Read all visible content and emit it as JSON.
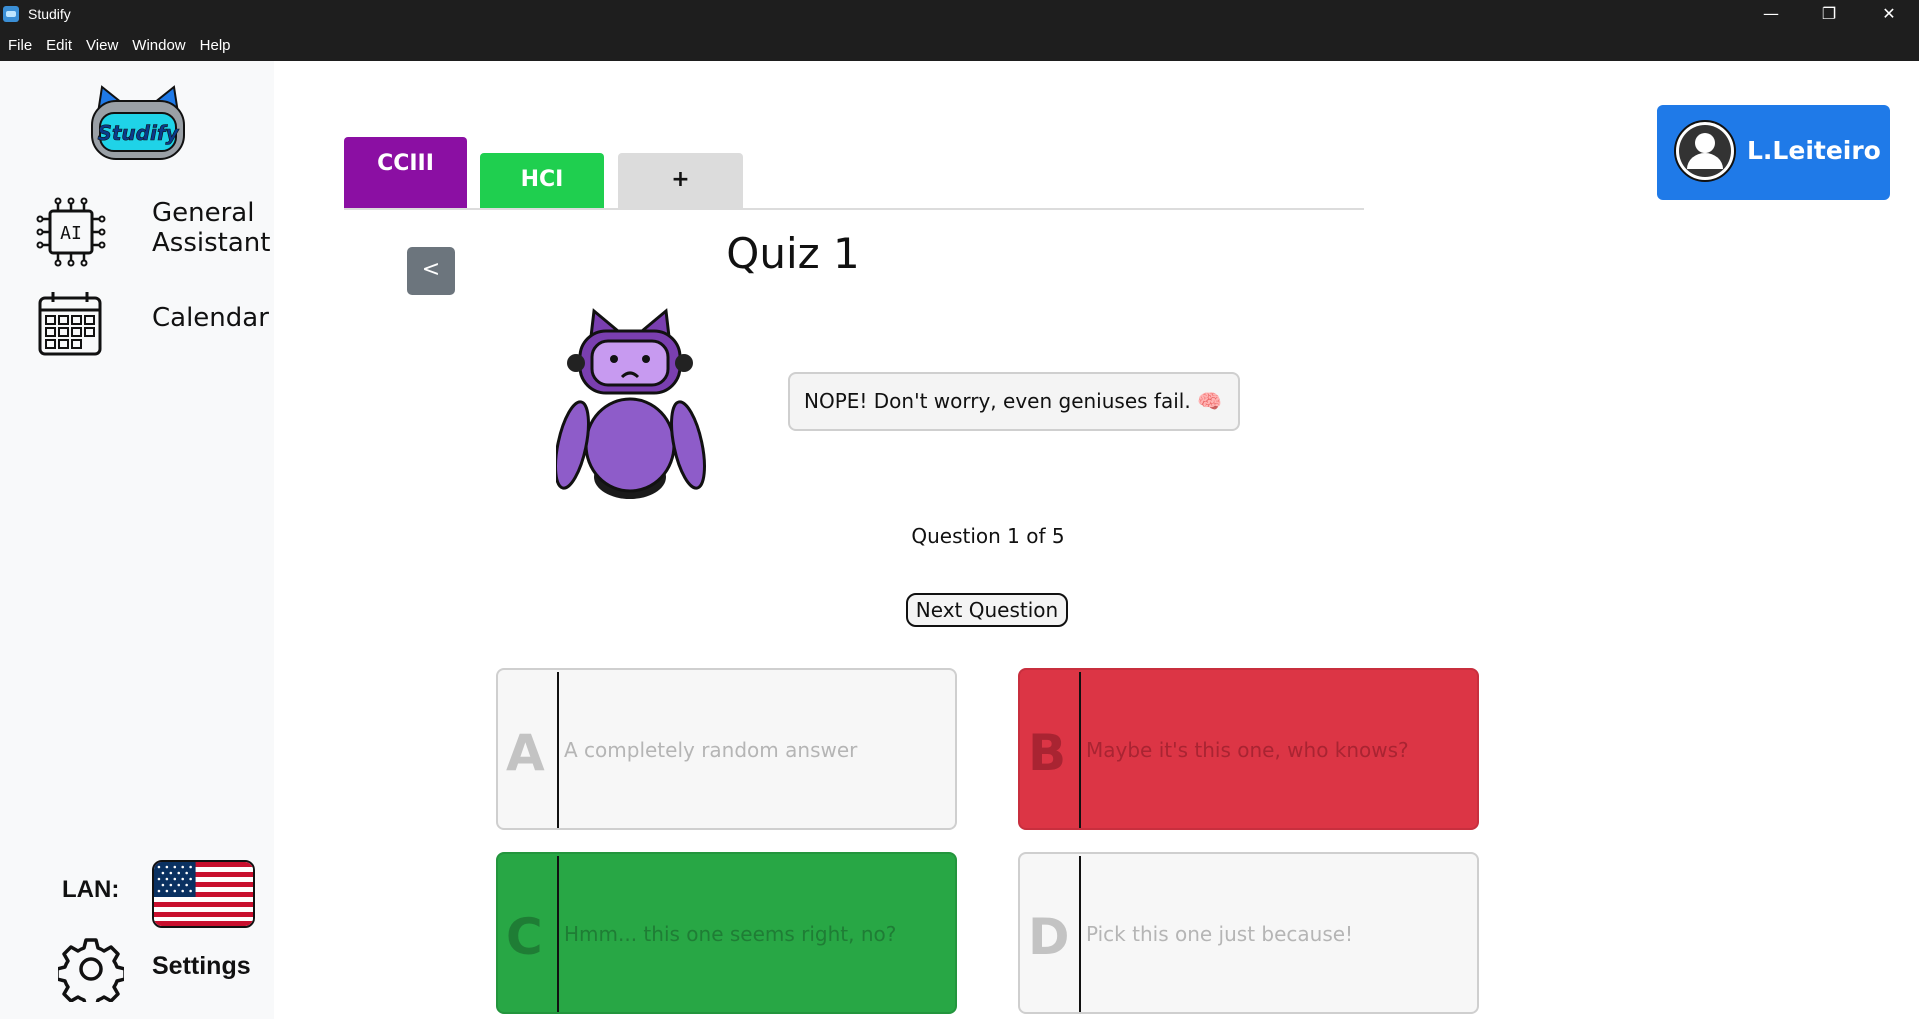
{
  "window": {
    "title": "Studify",
    "controls": {
      "minimize": "—",
      "maximize": "❐",
      "close": "✕"
    }
  },
  "menu": [
    "File",
    "Edit",
    "View",
    "Window",
    "Help"
  ],
  "sidebar": {
    "logo_text": "Studify",
    "items": [
      {
        "label_line1": "General",
        "label_line2": "Assistant",
        "icon": "ai-chip-icon"
      },
      {
        "label": "Calendar",
        "icon": "calendar-icon"
      }
    ],
    "language_label": "LAN:",
    "language_flag": "us-flag-icon",
    "settings_label": "Settings"
  },
  "tabs": [
    {
      "label": "CCIII",
      "color": "#8b0fa3",
      "active": true
    },
    {
      "label": "HCI",
      "color": "#1fcf4f"
    },
    {
      "label": "+",
      "color": "#dcdcdc"
    }
  ],
  "user": {
    "name": "L.Leiteiro",
    "color": "#1f7ae8"
  },
  "quiz": {
    "back_label": "<",
    "title": "Quiz 1",
    "feedback": "NOPE! Don't worry, even geniuses fail. 🧠",
    "counter": "Question 1 of 5",
    "next_label": "Next Question",
    "answers": [
      {
        "letter": "A",
        "text": "A completely random answer",
        "state": "neutral"
      },
      {
        "letter": "B",
        "text": "Maybe it's this one, who knows?",
        "state": "wrong",
        "color": "#dc3545"
      },
      {
        "letter": "C",
        "text": "Hmm... this one seems right, no?",
        "state": "correct",
        "color": "#28a745"
      },
      {
        "letter": "D",
        "text": "Pick this one just because!",
        "state": "neutral"
      }
    ]
  }
}
